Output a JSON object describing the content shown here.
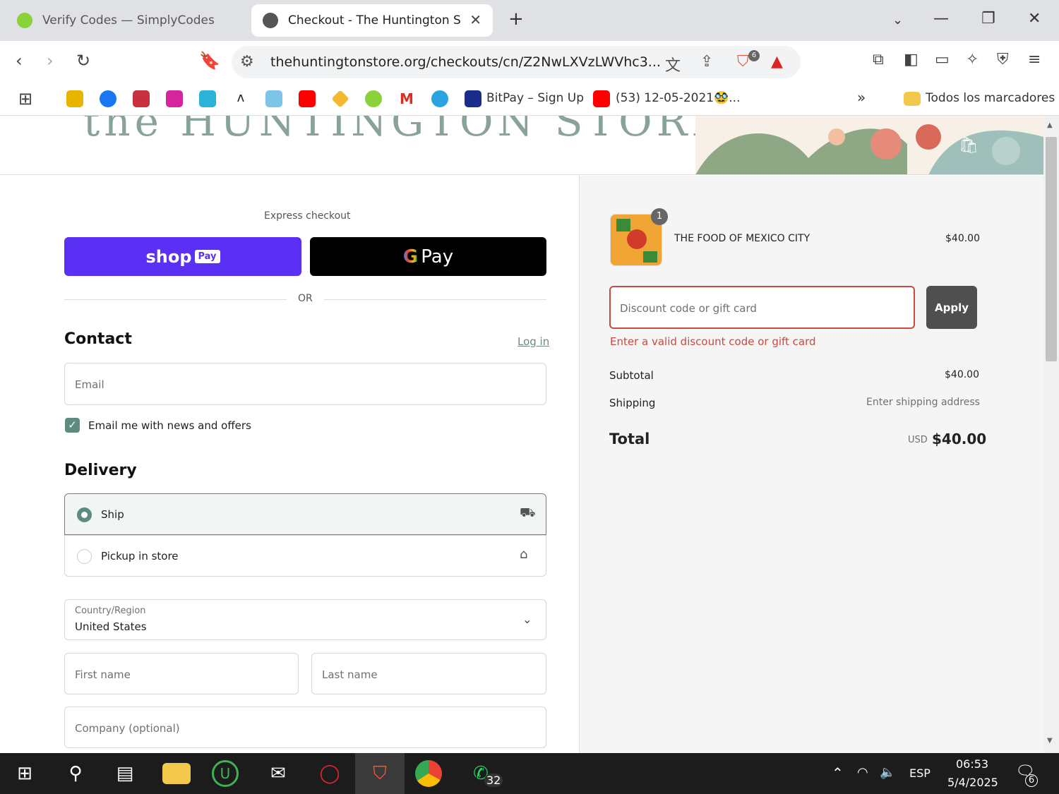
{
  "browser": {
    "tabs": [
      {
        "title": "Verify Codes — SimplyCodes",
        "active": false
      },
      {
        "title": "Checkout - The Huntington Sto",
        "active": true
      }
    ],
    "new_tab": "+",
    "address": "thehuntingtonstore.org/checkouts/cn/Z2NwLXVzLWVhc3...",
    "shield_count": "6",
    "bookmarks": [
      "BitPay – Sign Up",
      "(53) 12-05-2021🥸...",
      "Todos los marcadores"
    ],
    "overflow": "»"
  },
  "store": {
    "banner_title": "the HUNTINGTON STORE"
  },
  "checkout": {
    "express_label": "Express checkout",
    "shop_pay_label": "shop",
    "shop_pay_badge": "Pay",
    "gpay_g": "G",
    "gpay_label": "Pay",
    "or_label": "OR",
    "contact": {
      "heading": "Contact",
      "login_link": "Log in",
      "email_placeholder": "Email",
      "newsletter_label": "Email me with news and offers",
      "newsletter_checked": true
    },
    "delivery": {
      "heading": "Delivery",
      "options": [
        {
          "label": "Ship",
          "selected": true
        },
        {
          "label": "Pickup in store",
          "selected": false
        }
      ],
      "country_label": "Country/Region",
      "country_value": "United States",
      "first_name_placeholder": "First name",
      "last_name_placeholder": "Last name",
      "company_placeholder": "Company (optional)"
    }
  },
  "summary": {
    "item": {
      "name": "THE FOOD OF MEXICO CITY",
      "price": "$40.00",
      "quantity": "1"
    },
    "discount_placeholder": "Discount code or gift card",
    "apply_label": "Apply",
    "error": "Enter a valid discount code or gift card",
    "subtotal_label": "Subtotal",
    "subtotal_value": "$40.00",
    "shipping_label": "Shipping",
    "shipping_value": "Enter shipping address",
    "total_label": "Total",
    "currency": "USD",
    "total_value": "$40.00"
  },
  "taskbar": {
    "whatsapp_badge": "32",
    "lang": "ESP",
    "time": "06:53",
    "date": "5/4/2025",
    "notif_count": "6"
  },
  "colors": {
    "accent": "#5e8a80",
    "error": "#c94a3f",
    "shop_pay": "#5a31f4"
  }
}
